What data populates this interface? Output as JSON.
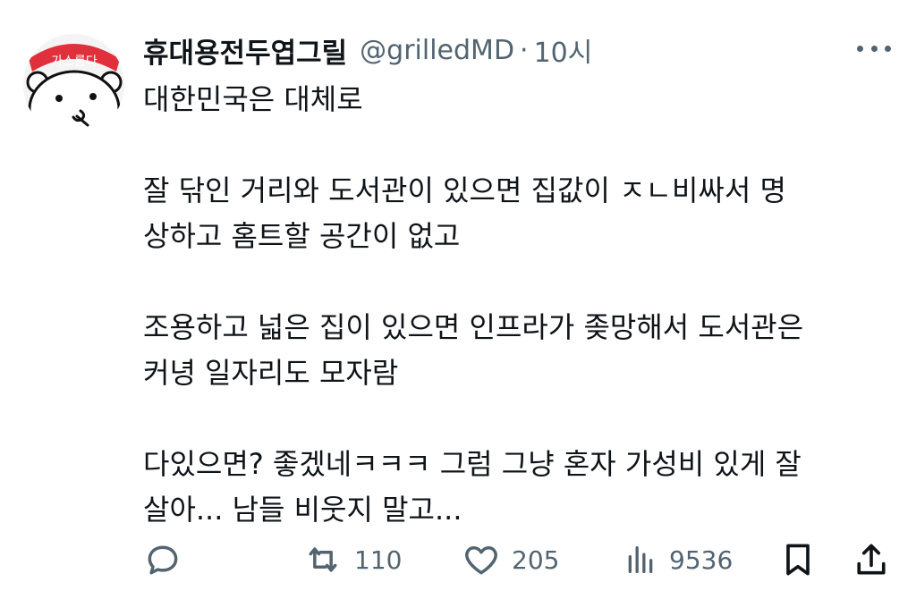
{
  "tweet": {
    "author_name": "휴대용전두엽그릴",
    "author_handle": "@grilledMD",
    "separator": "·",
    "time": "10시",
    "avatar_label": "가소롭다",
    "paragraphs": [
      {
        "lines": [
          "대한민국은 대체로"
        ]
      },
      {
        "lines": [
          "잘 닦인 거리와 도서관이 있으면 집값이 ㅈㄴ비싸서 명",
          "상하고 홈트할 공간이 없고"
        ]
      },
      {
        "lines": [
          "조용하고 넓은 집이 있으면 인프라가 좆망해서 도서관은",
          "커녕 일자리도 모자람"
        ]
      },
      {
        "lines": [
          "다있으면? 좋겠네ㅋㅋㅋ 그럼 그냥 혼자 가성비 있게 잘",
          "살아... 남들 비웃지 말고..."
        ]
      }
    ]
  },
  "actions": {
    "reply": {
      "icon": "reply-icon"
    },
    "retweet": {
      "icon": "retweet-icon",
      "count": "110"
    },
    "like": {
      "icon": "heart-icon",
      "count": "205"
    },
    "views": {
      "icon": "views-icon",
      "count": "9536"
    },
    "bookmark": {
      "icon": "bookmark-icon"
    },
    "share": {
      "icon": "share-icon"
    }
  },
  "colors": {
    "text": "#0f1419",
    "secondary": "#536471",
    "avatar_badge": "#e0303b"
  }
}
